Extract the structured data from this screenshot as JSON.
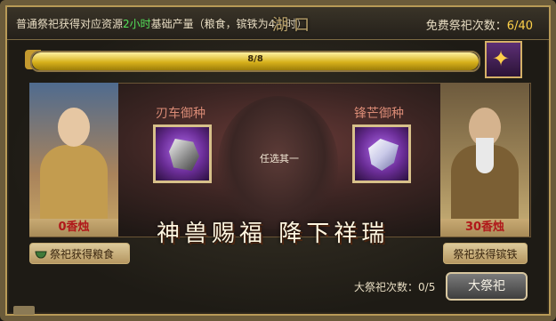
{
  "header": {
    "note_prefix": "普通祭祀获得对应资源",
    "note_highlight": "2小时",
    "note_suffix": "基础产量（粮食，镔铁为4小时）",
    "title": "湖口",
    "free_label": "免费祭祀次数：",
    "free_count": "6/40"
  },
  "progress": {
    "label": "8/8",
    "fraction": 1.0
  },
  "reward_icon": "dragon-icon",
  "left_panel": {
    "incense": "0香烛",
    "button": "祭祀获得粮食"
  },
  "right_panel": {
    "incense": "30香烛",
    "button": "祭祀获得镔铁"
  },
  "options": [
    {
      "title": "刃车御种",
      "icon": "ore-icon"
    },
    {
      "title": "锋芒御种",
      "icon": "crystal-icon"
    }
  ],
  "choose_text": "任选其一",
  "slogan": "神兽赐福 降下祥瑞",
  "grand": {
    "count_label": "大祭祀次数：",
    "count_value": "0/5",
    "button": "大祭祀"
  },
  "colors": {
    "accent_gold": "#d7b11b",
    "highlight_green": "#54e35a",
    "incense_red": "#b0181a"
  }
}
